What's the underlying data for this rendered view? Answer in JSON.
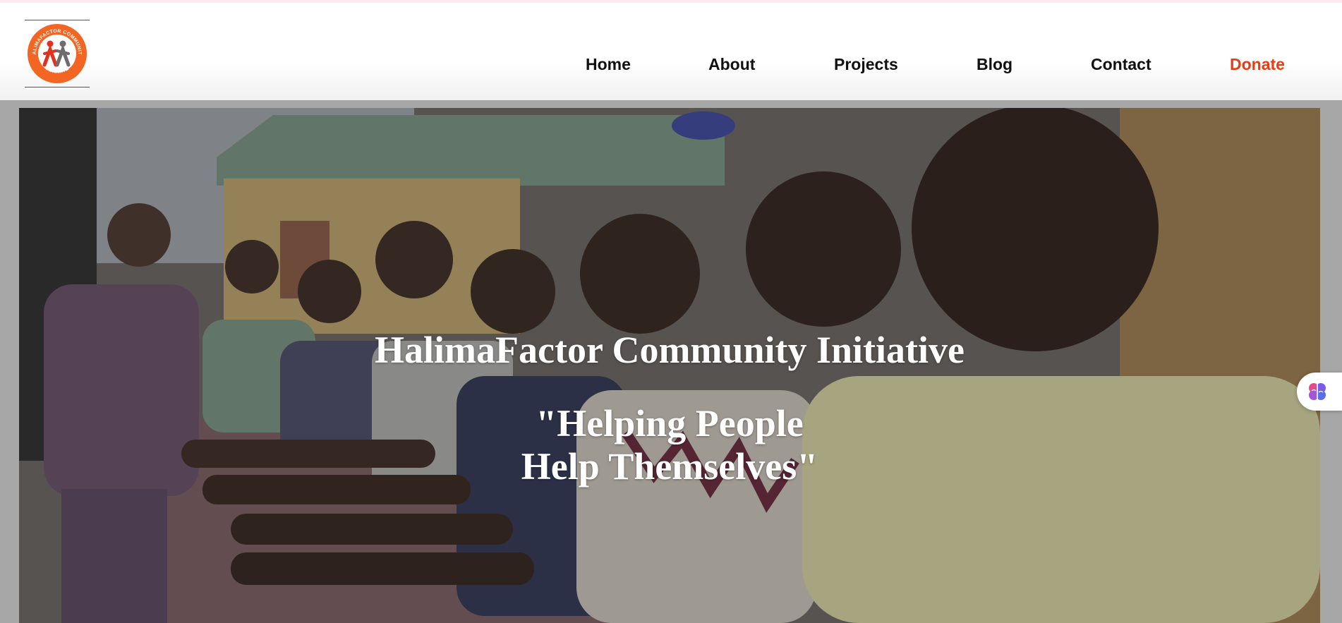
{
  "brand": {
    "logo_icon": "halimafactor-logo",
    "logo_ring_text": "HALIMAFACTOR COMMUNITY",
    "logo_bottom_text": "INITIATIVE",
    "logo_color": "#f26522"
  },
  "nav": {
    "items": [
      {
        "label": "Home"
      },
      {
        "label": "About"
      },
      {
        "label": "Projects"
      },
      {
        "label": "Blog"
      },
      {
        "label": "Contact"
      },
      {
        "label": "Donate"
      }
    ],
    "donate_color": "#ee3a12"
  },
  "hero": {
    "title": "HalimaFactor Community Initiative",
    "tagline_line1": "\"Helping People",
    "tagline_line2": "Help Themselves\""
  },
  "side_widget": {
    "icon": "brain-icon"
  }
}
